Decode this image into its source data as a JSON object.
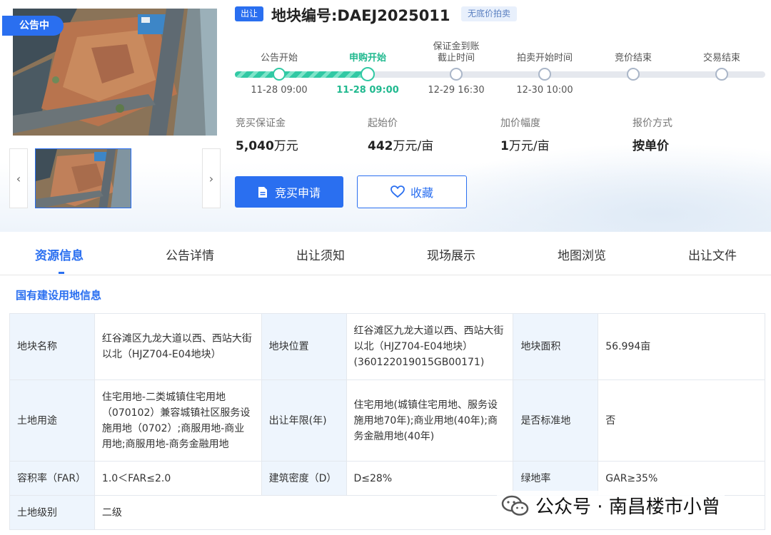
{
  "status_badge": "公告中",
  "title": {
    "tag": "出让",
    "text": "地块编号:DAEJ2025011",
    "reserve_tag": "无底价拍卖"
  },
  "timeline": {
    "progress_fraction": 0.25,
    "nodes": [
      {
        "label": "公告开始",
        "time": "11-28 09:00",
        "state": "done"
      },
      {
        "label": "申购开始",
        "time": "11-28 09:00",
        "state": "current"
      },
      {
        "label": "保证金到账\n截止时间",
        "label_line1": "保证金到账",
        "label_line2": "截止时间",
        "time": "12-29 16:30",
        "state": "pending"
      },
      {
        "label": "拍卖开始时间",
        "time": "12-30 10:00",
        "state": "pending"
      },
      {
        "label": "竞价结束",
        "time": "",
        "state": "pending"
      },
      {
        "label": "交易结束",
        "time": "",
        "state": "pending"
      }
    ]
  },
  "info": {
    "deposit_label": "竞买保证金",
    "deposit_number": "5,040",
    "deposit_unit": "万元",
    "start_label": "起始价",
    "start_number": "442",
    "start_unit": "万元/亩",
    "increment_label": "加价幅度",
    "increment_number": "1",
    "increment_unit": "万元/亩",
    "quote_label": "报价方式",
    "quote_value": "按单价"
  },
  "buttons": {
    "apply": "竞买申请",
    "favorite": "收藏"
  },
  "tabs": [
    "资源信息",
    "公告详情",
    "出让须知",
    "现场展示",
    "地图浏览",
    "出让文件"
  ],
  "section_title": "国有建设用地信息",
  "table": {
    "r1": {
      "k1": "地块名称",
      "v1": "红谷滩区九龙大道以西、西站大街以北（HJZ704-E04地块）",
      "k2": "地块位置",
      "v2": "红谷滩区九龙大道以西、西站大街以北（HJZ704-E04地块）(360122019015GB00171)",
      "k3": "地块面积",
      "v3": "56.994亩"
    },
    "r2": {
      "k1": "土地用途",
      "v1": "住宅用地-二类城镇住宅用地（070102）兼容城镇社区服务设施用地（0702）;商服用地-商业用地;商服用地-商务金融用地",
      "k2": "出让年限(年)",
      "v2": "住宅用地(城镇住宅用地、服务设施用地70年);商业用地(40年);商务金融用地(40年)",
      "k3": "是否标准地",
      "v3": "否"
    },
    "r3": {
      "k1": "容积率（FAR）",
      "v1": "1.0＜FAR≤2.0",
      "k2": "建筑密度（D）",
      "v2": "D≤28%",
      "k3": "绿地率",
      "v3": "GAR≥35%"
    },
    "r4": {
      "k1": "土地级别",
      "v1": "二级"
    }
  },
  "watermark": "公众号 · 南昌楼市小曾"
}
